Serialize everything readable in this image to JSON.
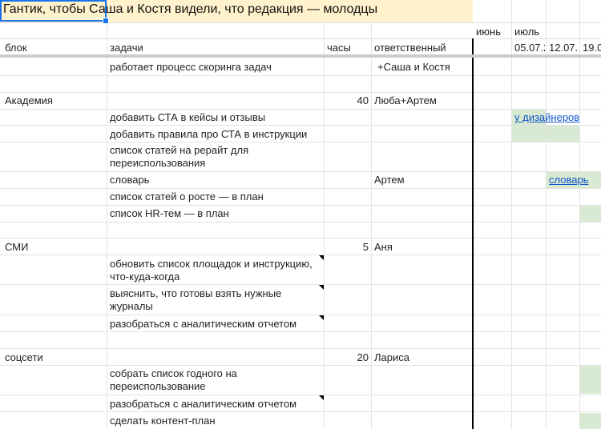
{
  "banner": {
    "title": "Гантик, чтобы Саша и Костя видели, что редакция — молодцы"
  },
  "months": {
    "june": "июнь",
    "july": "июль"
  },
  "headers": {
    "block": "блок",
    "tasks": "задачи",
    "hours": "часы",
    "owner": "ответственный",
    "dates": [
      "05.07.2",
      "12.07.2",
      "19.0"
    ]
  },
  "rows": {
    "intro": {
      "task": "работает процесс скоринга задач",
      "owner": "+Саша и Костя"
    },
    "academy": {
      "block": "Академия",
      "hours": "40",
      "owner": "Люба+Артем",
      "tasks": [
        "добавить СТА в кейсы и отзывы",
        "добавить правила про СТА в инструкции",
        "список статей на рерайт для переиспользования",
        "словарь",
        "список статей о росте — в план",
        "список HR-тем — в план"
      ],
      "dict_owner": "Артем",
      "link_designers": "у дизайнеров",
      "link_dict": "словарь"
    },
    "media": {
      "block": "СМИ",
      "hours": "5",
      "owner": "Аня",
      "tasks": [
        "обновить список площадок и инструкцию, что-куда-когда",
        "выяснить, что готовы взять нужные журналы",
        "разобраться с аналитическим отчетом"
      ]
    },
    "social": {
      "block": "соцсети",
      "hours": "20",
      "owner": "Лариса",
      "tasks": [
        "собрать список годного на переиспользование",
        "разобраться с аналитическим отчетом",
        "сделать контент-план"
      ]
    }
  },
  "colors": {
    "banner": "#fff2cc",
    "green": "#d9ead3",
    "link": "#1155cc",
    "selection": "#1a73e8"
  }
}
